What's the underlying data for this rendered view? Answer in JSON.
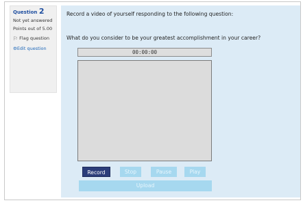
{
  "question_info": {
    "label": "Question",
    "number": "2",
    "status": "Not yet answered",
    "points": "Points out of 5.00",
    "flag_label": "Flag question",
    "flag_icon": "flag-icon",
    "edit_label": "Edit question",
    "edit_icon": "gear-icon"
  },
  "question": {
    "instruction": "Record a video of yourself responding to the following question:",
    "text": "What do you consider to be your greatest accomplishment in your career?"
  },
  "recorder": {
    "timer": "00:00:00",
    "record_label": "Record",
    "stop_label": "Stop",
    "pause_label": "Pause",
    "play_label": "Play",
    "upload_label": "Upload"
  },
  "colors": {
    "content_bg": "#dcebf6",
    "record_button": "#2b3d7a",
    "disabled_button": "#a6d8ef",
    "link": "#1a65b8"
  }
}
